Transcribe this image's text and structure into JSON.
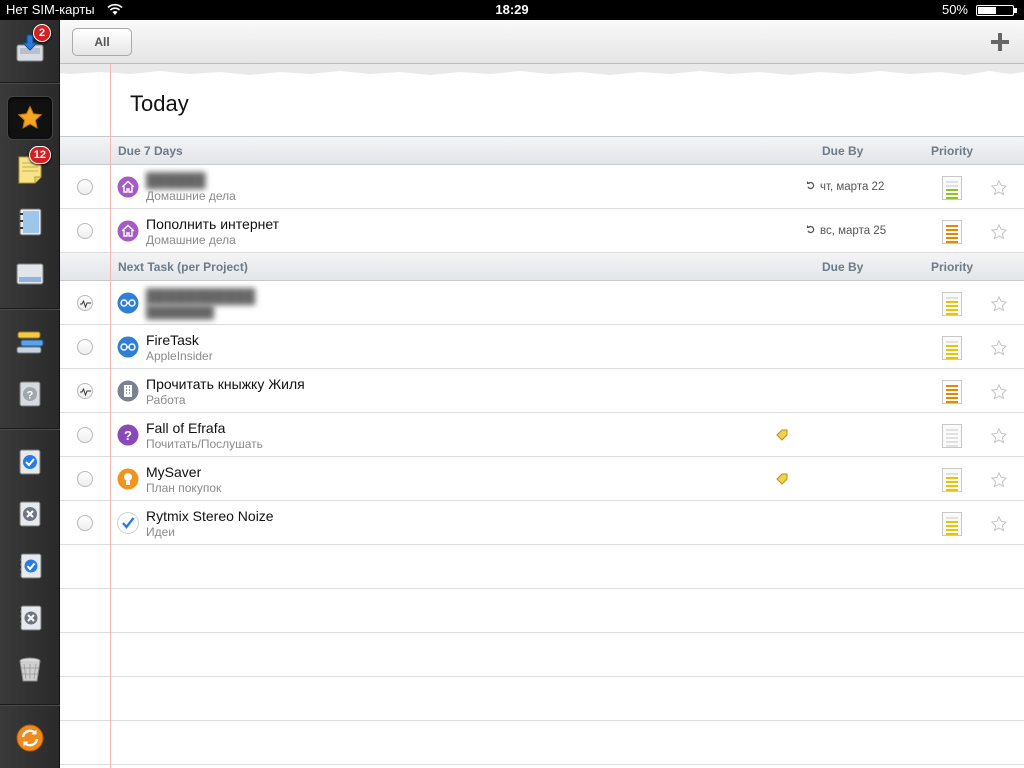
{
  "status_bar": {
    "carrier": "Нет SIM-карты",
    "time": "18:29",
    "battery": "50%"
  },
  "sidebar": {
    "items": [
      {
        "name": "inbox",
        "icon": "inbox-download-icon",
        "badge": "2"
      },
      {
        "name": "today",
        "icon": "star-icon",
        "badge": "",
        "active": true
      },
      {
        "name": "notes",
        "icon": "notepad-icon",
        "badge": "12"
      },
      {
        "name": "notebook",
        "icon": "notebook-icon",
        "badge": ""
      },
      {
        "name": "folders",
        "icon": "folder-icon",
        "badge": ""
      },
      {
        "name": "contexts",
        "icon": "stack-icon",
        "badge": ""
      },
      {
        "name": "someday",
        "icon": "question-card-icon",
        "badge": ""
      },
      {
        "name": "completed",
        "icon": "checked-card-icon",
        "badge": ""
      },
      {
        "name": "deleted",
        "icon": "cancel-card-icon",
        "badge": ""
      },
      {
        "name": "completed-archive",
        "icon": "checked-notebook-icon",
        "badge": ""
      },
      {
        "name": "deleted-archive",
        "icon": "cancel-notebook-icon",
        "badge": ""
      },
      {
        "name": "trash",
        "icon": "trash-basket-icon",
        "badge": ""
      },
      {
        "name": "sync",
        "icon": "sync-icon",
        "badge": ""
      }
    ]
  },
  "toolbar": {
    "filter_label": "All",
    "add_icon": "plus-icon"
  },
  "page": {
    "title": "Today"
  },
  "sections": [
    {
      "label": "Due 7 Days",
      "due_header": "Due By",
      "priority_header": "Priority",
      "tasks": [
        {
          "name": "",
          "blurred_name": true,
          "project": "Домашние дела",
          "icon": "home-icon",
          "icon_color": "#9b59b6",
          "due": "чт, марта 22",
          "repeat": true,
          "priority": 1,
          "status": "open"
        },
        {
          "name": "Пополнить интернет",
          "project": "Домашние дела",
          "icon": "home-icon",
          "icon_color": "#9b59b6",
          "due": "вс, марта 25",
          "repeat": true,
          "priority": 3,
          "status": "open"
        }
      ]
    },
    {
      "label": "Next Task (per Project)",
      "due_header": "Due By",
      "priority_header": "Priority",
      "tasks": [
        {
          "name": "",
          "blurred_name": true,
          "project": "",
          "icon": "glasses-icon",
          "icon_color": "#2f7fd6",
          "due": "",
          "priority": 2,
          "status": "in-progress"
        },
        {
          "name": "FireTask",
          "project": "AppleInsider",
          "icon": "glasses-icon",
          "icon_color": "#2f7fd6",
          "due": "",
          "priority": 2,
          "status": "open"
        },
        {
          "name": "Прочитать кныжку Жиля",
          "project": "Работа",
          "icon": "building-icon",
          "icon_color": "#7f8c8d",
          "due": "",
          "priority": 3,
          "status": "in-progress"
        },
        {
          "name": "Fall of Efrafa",
          "project": "Почитать/Послушать",
          "icon": "question-icon",
          "icon_color": "#8e44ad",
          "due": "",
          "note": true,
          "priority": 0,
          "status": "open"
        },
        {
          "name": "MySaver",
          "project": "План покупок",
          "icon": "lightbulb-icon",
          "icon_color": "#f39c12",
          "due": "",
          "note": true,
          "priority": 2,
          "status": "open"
        },
        {
          "name": "Rytmix Stereo Noize",
          "project": "Идеи",
          "icon": "checkmark-icon",
          "icon_color": "#ffffff",
          "due": "",
          "priority": 2,
          "status": "open"
        }
      ]
    }
  ],
  "colors": {
    "priority_low": "#8fc31f",
    "priority_medium": "#e8c400",
    "priority_high": "#e08a00",
    "margin_line": "#f2b8b8",
    "section_text": "#6d7a88"
  }
}
